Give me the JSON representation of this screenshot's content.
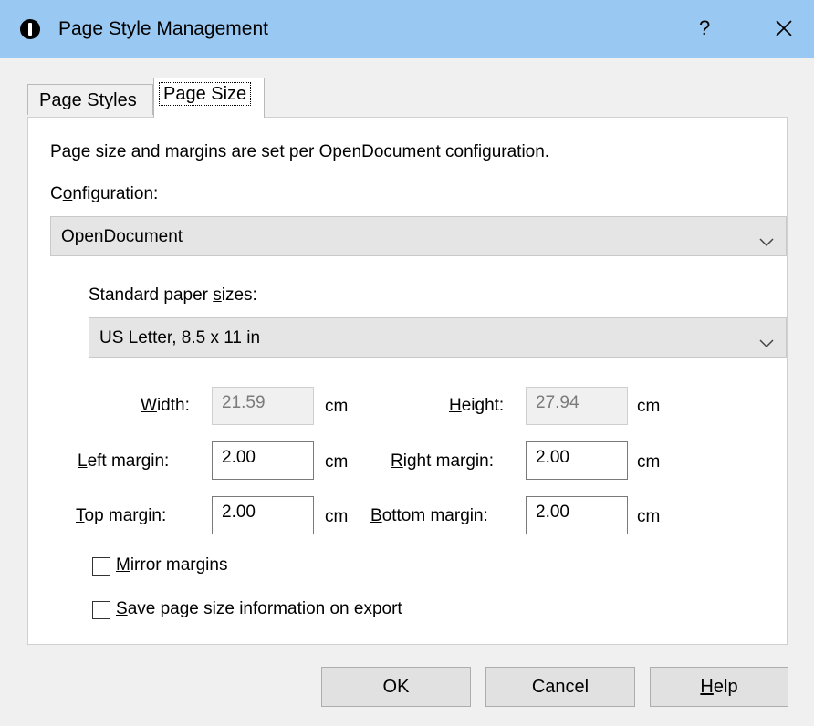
{
  "window": {
    "title": "Page Style Management",
    "help_glyph": "?"
  },
  "tabs": [
    {
      "label": "Page Styles",
      "active": false
    },
    {
      "label": "Page Size",
      "active": true
    }
  ],
  "page_size": {
    "description": "Page size and margins are set per OpenDocument configuration.",
    "configuration": {
      "label_before": "C",
      "label_mnemonic": "o",
      "label_after": "nfiguration:",
      "value": "OpenDocument"
    },
    "paper_sizes": {
      "label_before": "Standard paper ",
      "label_mnemonic": "s",
      "label_after": "izes:",
      "value": "US Letter, 8.5 x 11 in"
    },
    "width": {
      "label_mnemonic": "W",
      "label_after": "idth:",
      "value": "21.59",
      "unit": "cm"
    },
    "height": {
      "label_mnemonic": "H",
      "label_after": "eight:",
      "value": "27.94",
      "unit": "cm"
    },
    "left_margin": {
      "label_mnemonic": "L",
      "label_after": "eft margin:",
      "value": "2.00",
      "unit": "cm"
    },
    "right_margin": {
      "label_mnemonic": "R",
      "label_after": "ight margin:",
      "value": "2.00",
      "unit": "cm"
    },
    "top_margin": {
      "label_mnemonic": "T",
      "label_after": "op margin:",
      "value": "2.00",
      "unit": "cm"
    },
    "bottom_margin": {
      "label_mnemonic": "B",
      "label_after": "ottom margin:",
      "value": "2.00",
      "unit": "cm"
    },
    "mirror_margins": {
      "label_mnemonic": "M",
      "label_after": "irror margins",
      "checked": false
    },
    "save_info": {
      "label_mnemonic": "S",
      "label_after": "ave page size information on export",
      "checked": false
    }
  },
  "buttons": {
    "ok": "OK",
    "cancel": "Cancel",
    "help": {
      "label_mnemonic": "H",
      "label_after": "elp"
    }
  }
}
